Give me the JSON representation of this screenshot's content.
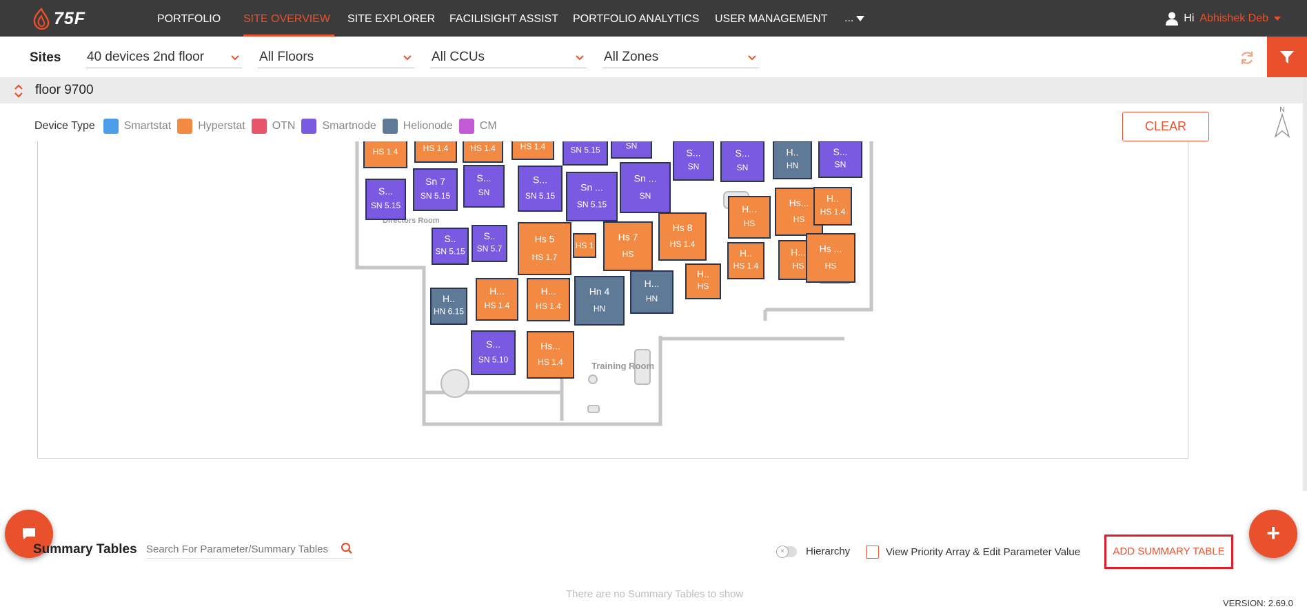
{
  "app": {
    "logo_text": "75F"
  },
  "nav": {
    "items": [
      {
        "label": "PORTFOLIO",
        "active": false
      },
      {
        "label": "SITE OVERVIEW",
        "active": true
      },
      {
        "label": "SITE EXPLORER",
        "active": false
      },
      {
        "label": "FACILISIGHT ASSIST",
        "active": false
      },
      {
        "label": "PORTFOLIO ANALYTICS",
        "active": false
      },
      {
        "label": "USER MANAGEMENT",
        "active": false
      }
    ],
    "more_label": "...",
    "greeting": "Hi",
    "user_name": "Abhishek Deb"
  },
  "filters": {
    "sites_label": "Sites",
    "site": "40 devices 2nd floor",
    "floors": "All Floors",
    "ccus": "All CCUs",
    "zones": "All Zones"
  },
  "floor": {
    "name": "floor 9700"
  },
  "legend": {
    "title": "Device Type",
    "items": [
      {
        "label": "Smartstat",
        "color": "#4a9ee8"
      },
      {
        "label": "Hyperstat",
        "color": "#f28a43"
      },
      {
        "label": "OTN",
        "color": "#e8546a"
      },
      {
        "label": "Smartnode",
        "color": "#7a5ae0"
      },
      {
        "label": "Helionode",
        "color": "#5f7a97"
      },
      {
        "label": "CM",
        "color": "#c45ad6"
      }
    ]
  },
  "clear_label": "CLEAR",
  "compass_label": "N",
  "floorplan": {
    "room_labels": [
      "Directors Room",
      "Training Room"
    ],
    "devices": [
      {
        "name": "",
        "sub": "HS 1.4",
        "type": "Hyperstat"
      },
      {
        "name": "",
        "sub": "HS 1.4",
        "type": "Hyperstat"
      },
      {
        "name": "",
        "sub": "HS 1.4",
        "type": "Hyperstat"
      },
      {
        "name": "",
        "sub": "HS 1.4",
        "type": "Hyperstat"
      },
      {
        "name": "",
        "sub": "SN 5.15",
        "type": "Smartnode"
      },
      {
        "name": "",
        "sub": "SN",
        "type": "Smartnode"
      },
      {
        "name": "S...",
        "sub": "SN",
        "type": "Smartnode"
      },
      {
        "name": "S...",
        "sub": "SN",
        "type": "Smartnode"
      },
      {
        "name": "H..",
        "sub": "HN",
        "type": "Helionode"
      },
      {
        "name": "S...",
        "sub": "SN",
        "type": "Smartnode"
      },
      {
        "name": "S...",
        "sub": "SN 5.15",
        "type": "Smartnode"
      },
      {
        "name": "Sn 7",
        "sub": "SN 5.15",
        "type": "Smartnode"
      },
      {
        "name": "S...",
        "sub": "SN",
        "type": "Smartnode"
      },
      {
        "name": "S...",
        "sub": "SN 5.15",
        "type": "Smartnode"
      },
      {
        "name": "Sn ...",
        "sub": "SN 5.15",
        "type": "Smartnode"
      },
      {
        "name": "Sn ...",
        "sub": "SN",
        "type": "Smartnode"
      },
      {
        "name": "H...",
        "sub": "HS",
        "type": "Hyperstat"
      },
      {
        "name": "Hs...",
        "sub": "HS",
        "type": "Hyperstat"
      },
      {
        "name": "H..",
        "sub": "HS 1.4",
        "type": "Hyperstat"
      },
      {
        "name": "S..",
        "sub": "SN 5.15",
        "type": "Smartnode"
      },
      {
        "name": "S..",
        "sub": "SN 5.7",
        "type": "Smartnode"
      },
      {
        "name": "Hs 5",
        "sub": "HS 1.7",
        "type": "Hyperstat"
      },
      {
        "name": "",
        "sub": "HS 1",
        "type": "Hyperstat"
      },
      {
        "name": "Hs 7",
        "sub": "HS",
        "type": "Hyperstat"
      },
      {
        "name": "Hs 8",
        "sub": "HS 1.4",
        "type": "Hyperstat"
      },
      {
        "name": "H..",
        "sub": "HS 1.4",
        "type": "Hyperstat"
      },
      {
        "name": "H...",
        "sub": "HS",
        "type": "Hyperstat"
      },
      {
        "name": "Hs ...",
        "sub": "HS",
        "type": "Hyperstat"
      },
      {
        "name": "H..",
        "sub": "HS",
        "type": "Hyperstat"
      },
      {
        "name": "H..",
        "sub": "HN 6.15",
        "type": "Helionode"
      },
      {
        "name": "H...",
        "sub": "HS 1.4",
        "type": "Hyperstat"
      },
      {
        "name": "H...",
        "sub": "HS 1.4",
        "type": "Hyperstat"
      },
      {
        "name": "Hn 4",
        "sub": "HN",
        "type": "Helionode"
      },
      {
        "name": "H...",
        "sub": "HN",
        "type": "Helionode"
      },
      {
        "name": "S...",
        "sub": "SN 5.10",
        "type": "Smartnode"
      },
      {
        "name": "Hs...",
        "sub": "HS 1.4",
        "type": "Hyperstat"
      }
    ]
  },
  "summary": {
    "title": "Summary Tables",
    "search_placeholder": "Search For Parameter/Summary Tables",
    "hierarchy_label": "Hierarchy",
    "priority_label": "View Priority Array & Edit Parameter Value",
    "add_label": "ADD SUMMARY TABLE",
    "empty_message": "There are no Summary Tables to show"
  },
  "version": "VERSION: 2.69.0",
  "colors": {
    "accent": "#e8512b",
    "nav_bg": "#3b3b3b"
  }
}
